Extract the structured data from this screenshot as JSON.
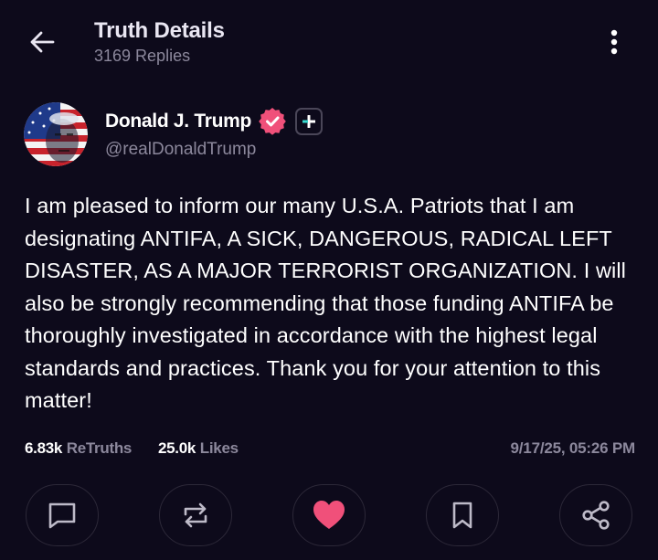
{
  "header": {
    "title": "Truth Details",
    "subtitle": "3169 Replies",
    "back_icon": "arrow-left-icon",
    "menu_icon": "more-vertical-icon"
  },
  "author": {
    "display_name": "Donald J. Trump",
    "handle": "@realDonaldTrump",
    "verified": true,
    "verified_color": "#f0507a",
    "plus_accent": "#37d9cf"
  },
  "post": {
    "text": "I am pleased to inform our many U.S.A. Patriots that I am designating ANTIFA, A SICK, DANGEROUS, RADICAL LEFT DISASTER, AS A MAJOR TERRORIST ORGANIZATION. I will also be strongly recommending that those funding ANTIFA be thoroughly investigated in accordance with the highest legal standards and practices. Thank you for your attention to this matter!"
  },
  "stats": {
    "retruths_count": "6.83k",
    "retruths_label": "ReTruths",
    "likes_count": "25.0k",
    "likes_label": "Likes",
    "timestamp": "9/17/25, 05:26 PM"
  },
  "actions": [
    {
      "name": "reply",
      "icon": "comment-icon"
    },
    {
      "name": "retruth",
      "icon": "repost-icon"
    },
    {
      "name": "like",
      "icon": "heart-icon",
      "active": true,
      "color": "#f0507a"
    },
    {
      "name": "bookmark",
      "icon": "bookmark-icon"
    },
    {
      "name": "share",
      "icon": "share-icon"
    }
  ],
  "colors": {
    "background": "#0d0a1b",
    "muted_text": "#8c889c",
    "border": "#2c2838",
    "accent_pink": "#f0507a"
  }
}
